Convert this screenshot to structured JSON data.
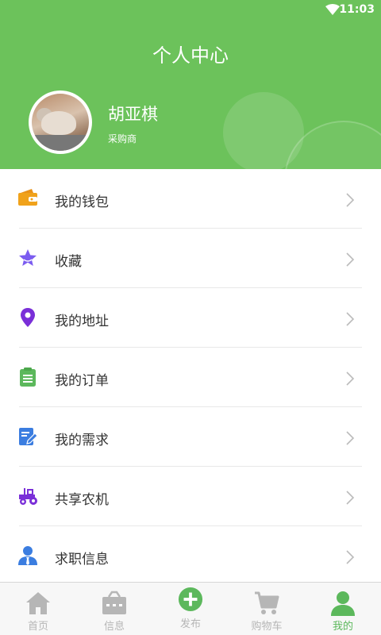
{
  "status_bar": {
    "time": "11:03"
  },
  "header": {
    "title": "个人中心",
    "user_name": "胡亚棋",
    "user_role": "采购商",
    "bg_color": "#6cc25b"
  },
  "menu": {
    "items": [
      {
        "label": "我的钱包",
        "icon": "wallet-icon",
        "color": "#f0a21b"
      },
      {
        "label": "收藏",
        "icon": "star-icon",
        "color": "#7b5cf0"
      },
      {
        "label": "我的地址",
        "icon": "location-pin-icon",
        "color": "#7a2fd8"
      },
      {
        "label": "我的订单",
        "icon": "clipboard-icon",
        "color": "#5cb85c"
      },
      {
        "label": "我的需求",
        "icon": "edit-document-icon",
        "color": "#3b7de0"
      },
      {
        "label": "共享农机",
        "icon": "tractor-icon",
        "color": "#7a2fd8"
      },
      {
        "label": "求职信息",
        "icon": "person-tie-icon",
        "color": "#3b7de0"
      }
    ]
  },
  "tabbar": {
    "tabs": [
      {
        "label": "首页",
        "icon": "home-icon",
        "active": false
      },
      {
        "label": "信息",
        "icon": "message-icon",
        "active": false
      },
      {
        "label": "发布",
        "icon": "add-circle-icon",
        "active": false
      },
      {
        "label": "购物车",
        "icon": "cart-icon",
        "active": false
      },
      {
        "label": "我的",
        "icon": "user-icon",
        "active": true
      }
    ],
    "active_color": "#5cb85c",
    "inactive_color": "#b6b6b6"
  }
}
